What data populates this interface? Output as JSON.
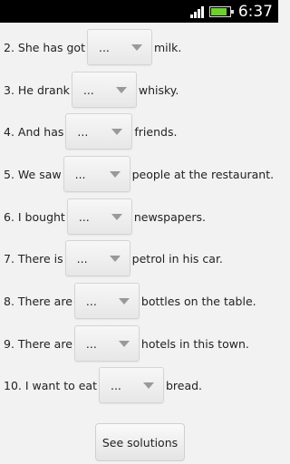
{
  "status_bar": {
    "time": "6:37",
    "battery_level": 0.85,
    "battery_color": "#6fcf2f",
    "signal_icon": "signal-bars-icon",
    "battery_icon": "battery-icon"
  },
  "questions": [
    {
      "before": "2. She has got",
      "selected": "...",
      "after": "milk."
    },
    {
      "before": "3. He drank",
      "selected": "...",
      "after": "whisky."
    },
    {
      "before": "4. And has",
      "selected": "...",
      "after": "friends."
    },
    {
      "before": "5. We saw",
      "selected": "...",
      "after": "people at the restaurant."
    },
    {
      "before": "6. I bought",
      "selected": "...",
      "after": "newspapers."
    },
    {
      "before": "7. There is",
      "selected": "...",
      "after": "petrol in his car."
    },
    {
      "before": "8. There are",
      "selected": "...",
      "after": "bottles on the table."
    },
    {
      "before": "9. There are",
      "selected": "...",
      "after": "hotels in this town."
    },
    {
      "before": "10. I want to eat",
      "selected": "...",
      "after": "bread."
    }
  ],
  "see_solutions_label": "See solutions"
}
